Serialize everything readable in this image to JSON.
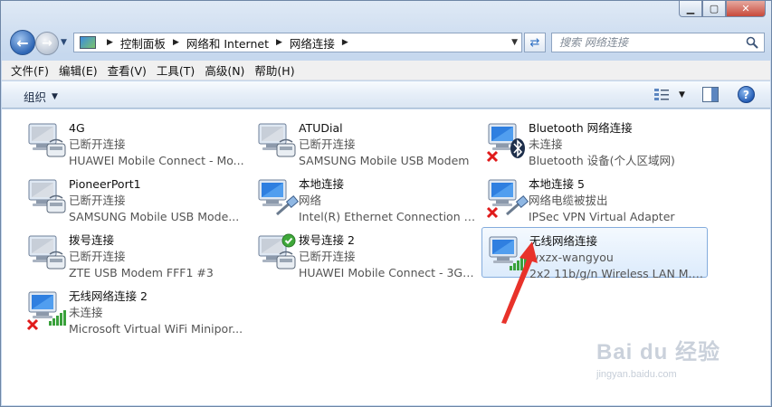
{
  "window": {
    "minimize_label": "▁",
    "maximize_label": "▢",
    "close_label": "✕"
  },
  "address": {
    "segments": [
      "控制面板",
      "网络和 Internet",
      "网络连接"
    ]
  },
  "search": {
    "placeholder": "搜索 网络连接"
  },
  "menu": [
    "文件(F)",
    "编辑(E)",
    "查看(V)",
    "工具(T)",
    "高级(N)",
    "帮助(H)"
  ],
  "toolbar": {
    "organize_label": "组织",
    "help_label": "?"
  },
  "connections": [
    {
      "name": "4G",
      "status": "已断开连接",
      "device": "HUAWEI Mobile Connect - Mo...",
      "type": "modem",
      "badge": "none",
      "selected": false
    },
    {
      "name": "ATUDial",
      "status": "已断开连接",
      "device": "SAMSUNG Mobile USB Modem",
      "type": "modem",
      "badge": "none",
      "selected": false
    },
    {
      "name": "Bluetooth 网络连接",
      "status": "未连接",
      "device": "Bluetooth 设备(个人区域网)",
      "type": "bluetooth",
      "badge": "x",
      "selected": false
    },
    {
      "name": "PioneerPort1",
      "status": "已断开连接",
      "device": "SAMSUNG Mobile USB Mode...",
      "type": "modem",
      "badge": "none",
      "selected": false
    },
    {
      "name": "本地连接",
      "status": "网络",
      "device": "Intel(R) Ethernet Connection I2...",
      "type": "ethernet",
      "badge": "none",
      "selected": false
    },
    {
      "name": "本地连接 5",
      "status": "网络电缆被拔出",
      "device": "IPSec VPN Virtual Adapter",
      "type": "ethernet",
      "badge": "x",
      "selected": false
    },
    {
      "name": "拨号连接",
      "status": "已断开连接",
      "device": "ZTE USB Modem FFF1 #3",
      "type": "modem",
      "badge": "none",
      "selected": false
    },
    {
      "name": "拨号连接 2",
      "status": "已断开连接",
      "device": "HUAWEI Mobile Connect - 3G ...",
      "type": "modem",
      "badge": "check",
      "selected": false
    },
    {
      "name": "无线网络连接",
      "status": "wxzx-wangyou",
      "device": "2x2 11b/g/n Wireless LAN M.2...",
      "type": "wifi",
      "badge": "none",
      "selected": true
    },
    {
      "name": "无线网络连接 2",
      "status": "未连接",
      "device": "Microsoft Virtual WiFi Minipor...",
      "type": "wifi",
      "badge": "x",
      "selected": false
    }
  ],
  "watermark": {
    "logo": "Bai du 经验",
    "url": "jingyan.baidu.com"
  },
  "colors": {
    "accent": "#2e66b5",
    "selection": "#dcebfc",
    "arrow": "#e8322a"
  }
}
